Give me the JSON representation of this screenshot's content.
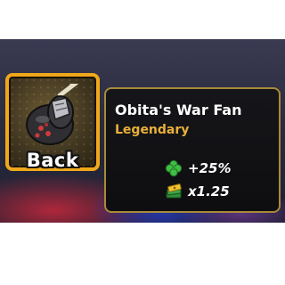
{
  "back_button": {
    "label": "Back"
  },
  "item": {
    "name": "Obita's War Fan",
    "rarity": "Legendary",
    "rarity_color": "#e9b03a",
    "icon": "war-fan-icon"
  },
  "stats": [
    {
      "icon": "clover-icon",
      "value": "+25%"
    },
    {
      "icon": "cash-stack-icon",
      "value": "x1.25"
    }
  ],
  "colors": {
    "slot_border": "#f0a81a",
    "card_border": "#a88a3a",
    "card_background": "#0e0e10"
  }
}
